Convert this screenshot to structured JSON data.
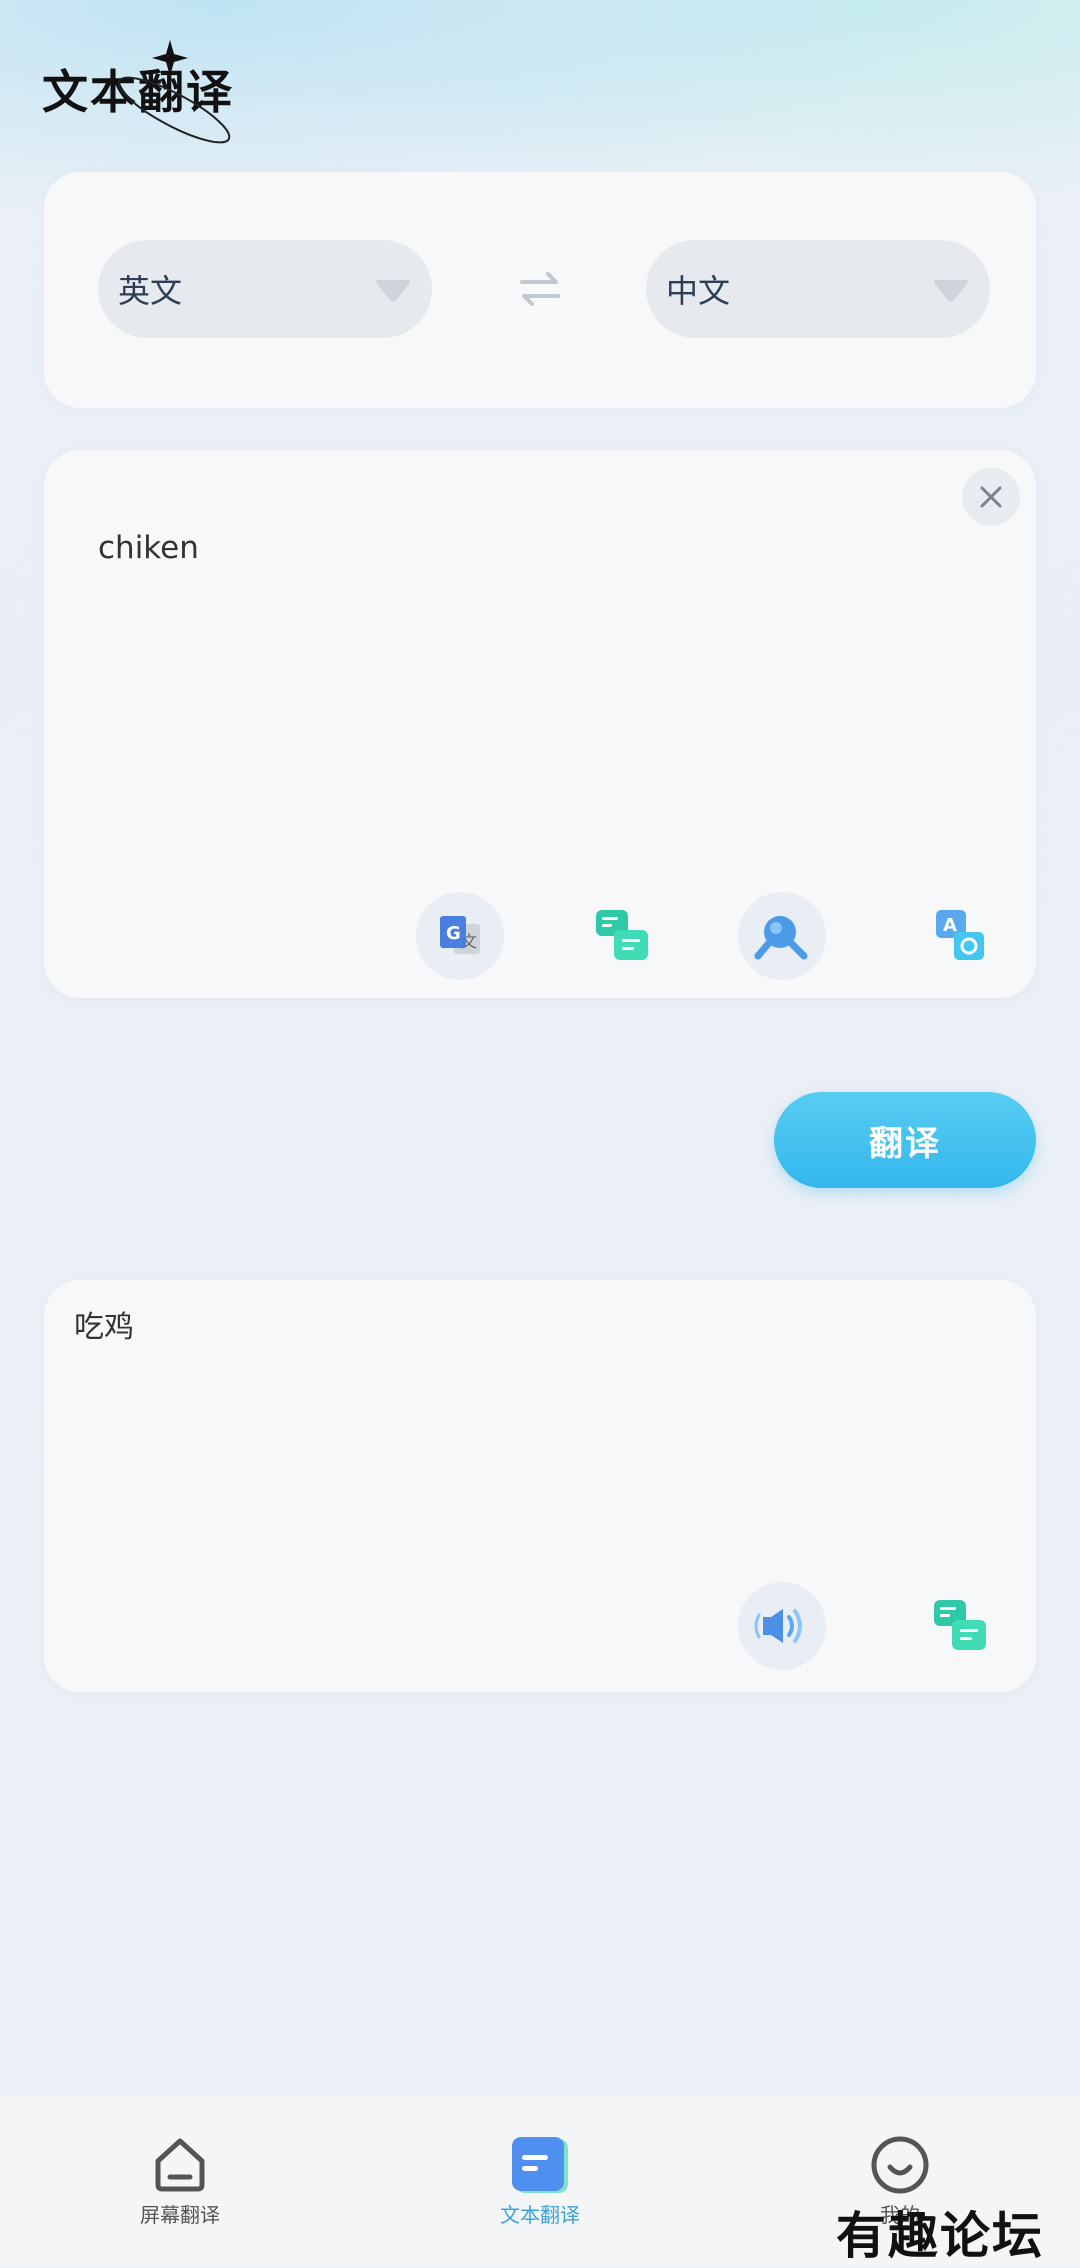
{
  "header": {
    "title": "文本翻译"
  },
  "language_selector": {
    "source": "英文",
    "target": "中文"
  },
  "input_card": {
    "text": "chiken",
    "tools": [
      "google-translate-icon",
      "dialogue-translate-icon",
      "dictionary-search-icon",
      "image-translate-icon"
    ]
  },
  "actions": {
    "translate_label": "翻译"
  },
  "result_card": {
    "text": "吃鸡",
    "tools": [
      "speaker-icon",
      "dialogue-translate-icon"
    ]
  },
  "bottom_nav": {
    "items": [
      {
        "label": "屏幕翻译",
        "icon": "home-icon"
      },
      {
        "label": "文本翻译",
        "icon": "document-icon",
        "active": true
      },
      {
        "label": "我的",
        "icon": "smile-icon"
      }
    ]
  },
  "watermark": {
    "text": "有趣论坛"
  },
  "colors": {
    "accent": "#3ab9ee",
    "card": "#f7f8f9",
    "background": "#ebeff6"
  }
}
